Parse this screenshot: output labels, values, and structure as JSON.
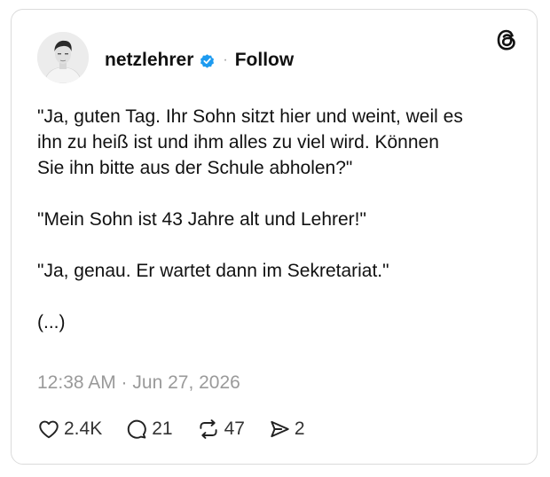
{
  "post": {
    "username": "netzlehrer",
    "follow_label": "Follow",
    "separator": "·",
    "paragraphs": [
      "\"Ja, guten Tag. Ihr Sohn sitzt hier und weint, weil es\nihn zu heiß ist und ihm alles zu viel wird. Können\nSie ihn bitte aus der Schule abholen?\"",
      "\"Mein Sohn ist 43 Jahre alt und Lehrer!\"",
      "\"Ja, genau. Er wartet dann im Sekretariat.\"",
      "(...)"
    ],
    "timestamp": "12:38 AM · Jun 27, 2026"
  },
  "actions": {
    "likes": "2.4K",
    "replies": "21",
    "reposts": "47",
    "shares": "2"
  },
  "icons": {
    "verified": "verified-badge-icon",
    "logo": "threads-logo-icon",
    "like": "heart-icon",
    "reply": "speech-bubble-icon",
    "repost": "repost-icon",
    "share": "send-icon"
  },
  "colors": {
    "verified_blue": "#1d9bf0",
    "text": "#111111",
    "muted": "#9a9a9a",
    "border": "#dbdbdb"
  }
}
